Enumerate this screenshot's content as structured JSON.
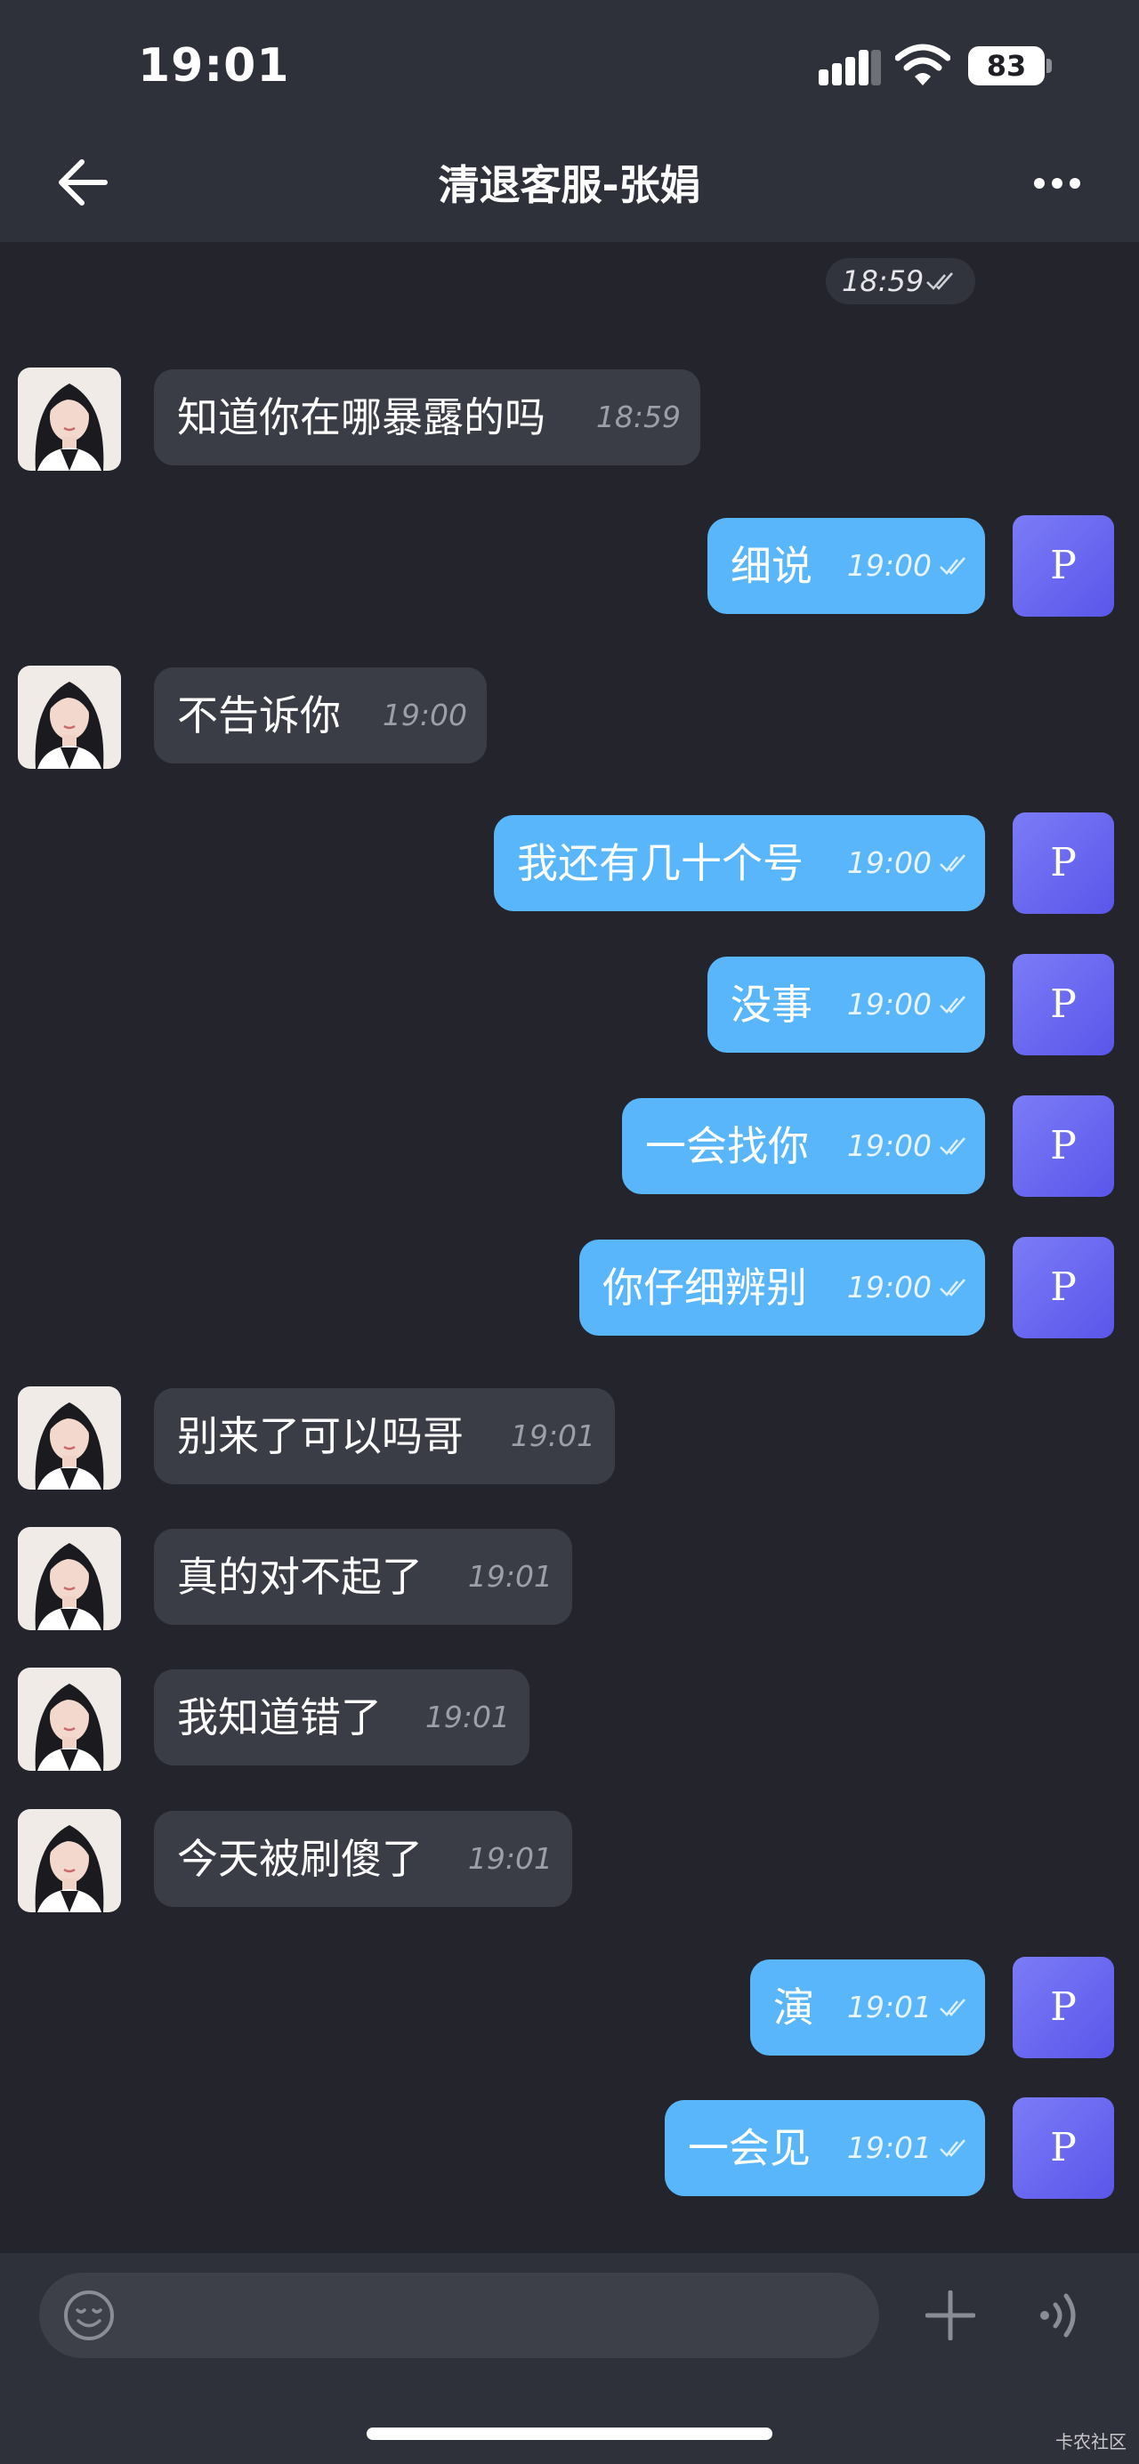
{
  "status_bar": {
    "time": "19:01",
    "battery": "83"
  },
  "header": {
    "title": "清退客服-张娟"
  },
  "date_pill": "18:59",
  "messages": [
    {
      "side": "in",
      "text": "知道你在哪暴露的吗",
      "time": "18:59"
    },
    {
      "side": "out",
      "text": "细说",
      "time": "19:00",
      "avatar": "P"
    },
    {
      "side": "in",
      "text": "不告诉你",
      "time": "19:00"
    },
    {
      "side": "out",
      "text": "我还有几十个号",
      "time": "19:00",
      "avatar": "P"
    },
    {
      "side": "out",
      "text": "没事",
      "time": "19:00",
      "avatar": "P"
    },
    {
      "side": "out",
      "text": "一会找你",
      "time": "19:00",
      "avatar": "P"
    },
    {
      "side": "out",
      "text": "你仔细辨别",
      "time": "19:00",
      "avatar": "P"
    },
    {
      "side": "in",
      "text": "别来了可以吗哥",
      "time": "19:01"
    },
    {
      "side": "in",
      "text": "真的对不起了",
      "time": "19:01"
    },
    {
      "side": "in",
      "text": "我知道错了",
      "time": "19:01"
    },
    {
      "side": "in",
      "text": "今天被刷傻了",
      "time": "19:01"
    },
    {
      "side": "out",
      "text": "演",
      "time": "19:01",
      "avatar": "P"
    },
    {
      "side": "out",
      "text": "一会见",
      "time": "19:01",
      "avatar": "P"
    }
  ],
  "input": {
    "placeholder": ""
  },
  "watermark": "卡农社区",
  "colors": {
    "background": "#24252c",
    "header": "#2f313a",
    "incoming_bubble": "#3a3c46",
    "outgoing_bubble": "#5ab6fb",
    "my_avatar": "#6a68f0"
  }
}
